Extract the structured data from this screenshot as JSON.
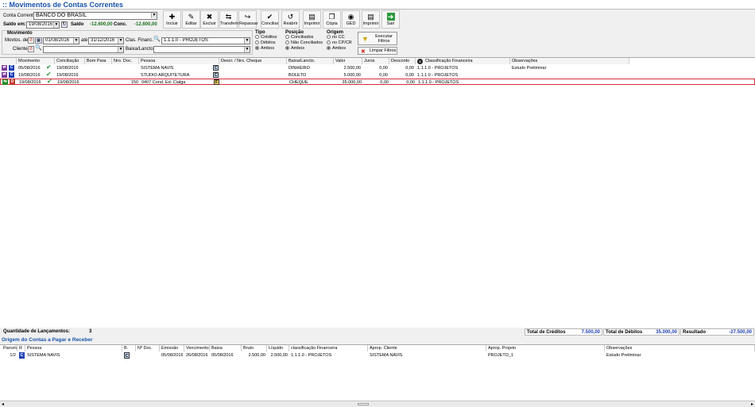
{
  "window": {
    "title": ":: Movimentos de Contas Correntes"
  },
  "account": {
    "label": "Conta Corrente",
    "value": "BANCO DO BRASIL"
  },
  "saldo": {
    "em_label": "Saldo em:",
    "date": "19/08/2016",
    "saldo_label": "Saldo",
    "saldo_value": "-12.600,00",
    "conc_label": "Conc.",
    "conc_value": "-12.600,00"
  },
  "toolbar": [
    {
      "label": "Incluir",
      "icon": "include-icon"
    },
    {
      "label": "Editar",
      "icon": "edit-icon"
    },
    {
      "label": "Excluir",
      "icon": "delete-icon"
    },
    {
      "label": "Transferir",
      "icon": "transfer-icon"
    },
    {
      "label": "Repassar",
      "icon": "forward-icon"
    },
    {
      "label": "Conciliar",
      "icon": "reconcile-icon"
    },
    {
      "label": "Reabrir",
      "icon": "reopen-icon"
    },
    {
      "label": "Imprimir",
      "icon": "print-icon"
    },
    {
      "label": "Cópia",
      "icon": "copy-icon"
    },
    {
      "label": "GED",
      "icon": "ged-icon"
    },
    {
      "label": "Imprimir",
      "icon": "print-icon"
    },
    {
      "label": "Sair",
      "icon": "exit-icon"
    }
  ],
  "filters": {
    "movimento_title": "Movimento",
    "movtos_label": "Movtos. de",
    "date_from": "01/08/2016",
    "ate_label": "até",
    "date_to": "31/12/2016",
    "cliente_label": "Cliente",
    "clasfinanc_label": "Clas. Financ.",
    "clasfinanc_value": "1.1.1.0 - PROJETOS",
    "baixa_label": "Baixa/Lancto."
  },
  "tipo": {
    "title": "Tipo",
    "options": [
      "Créditos",
      "Débitos",
      "Ambos"
    ],
    "selected": 2
  },
  "posicao": {
    "title": "Posição",
    "options": [
      "Conciliados",
      "Não Conciliados",
      "Ambos"
    ],
    "selected": 2
  },
  "origem": {
    "title": "Origem",
    "options": [
      "no CC",
      "no CP/CR",
      "Ambos"
    ],
    "selected": 2
  },
  "buttons": {
    "executar": "Executar Filtros",
    "limpar": "Limpar Filtros"
  },
  "grid": {
    "headers": [
      "Movimento",
      "Conciliação",
      "Bom Para",
      "Nro. Doc.",
      "Pessoa",
      "Descr. / Nro. Cheque",
      "Baixa/Lancto.",
      "Valor",
      "Juros",
      "Desconto",
      "Classificação Financeira",
      "Observações"
    ],
    "rows": [
      {
        "type": "C",
        "movimento": "05/08/2016",
        "conciliacao": "19/08/2016",
        "bompara": "",
        "nrodoc": "",
        "pessoa": "SISTEMA NAVIS",
        "tag": "C",
        "descr": "",
        "baixa": "DINHEIRO",
        "valor": "2.500,00",
        "juros": "0,00",
        "desconto": "0,00",
        "classif": "1.1.1.0 - PROJETOS",
        "obs": "Estudo Preliminar"
      },
      {
        "type": "C",
        "movimento": "19/08/2016",
        "conciliacao": "19/08/2016",
        "bompara": "",
        "nrodoc": "",
        "pessoa": "STUDIO ARQUITETURA",
        "tag": "C",
        "descr": "",
        "baixa": "BOLETO",
        "valor": "5.000,00",
        "juros": "0,00",
        "desconto": "0,00",
        "classif": "1.1.1.0 - PROJETOS",
        "obs": ""
      },
      {
        "type": "D",
        "movimento": "19/08/2016",
        "conciliacao": "19/08/2016",
        "bompara": "",
        "nrodoc": "150",
        "pessoa": "0407 Cond. Ed. Cialga",
        "tag": "F",
        "descr": "",
        "baixa": "CHEQUE",
        "valor": "35.000,00",
        "juros": "0,00",
        "desconto": "0,00",
        "classif": "1.1.1.0 - PROJETOS",
        "obs": ""
      }
    ]
  },
  "totals": {
    "qtd_label": "Quantidade de Lançamentos:",
    "qtd_value": "3",
    "creditos_label": "Total de Créditos",
    "creditos_value": "7.500,00",
    "debitos_label": "Total de Débitos",
    "debitos_value": "35.000,00",
    "resultado_label": "Resultado",
    "resultado_value": "-27.500,00"
  },
  "origin": {
    "title": "Origem do Contas a Pagar e Receber",
    "headers": [
      "Parcela",
      "R",
      "Pessoa",
      "B.",
      "Nº Doc.",
      "Emissão",
      "Vencimento",
      "Baixa",
      "Bruto",
      "Líquido",
      "classificação Financeira",
      "Aprop. Cliente",
      "Aprop. Projeto",
      "Observações"
    ],
    "rows": [
      {
        "parcela": "1/2",
        "r": "C",
        "pessoa": "SISTEMA NAVIS",
        "b": "C",
        "nrodoc": "",
        "emissao": "05/08/2016",
        "vencimento": "26/08/2016",
        "baixa": "05/08/2016",
        "bruto": "2.500,00",
        "liquido": "2.500,00",
        "classif": "1.1.1.0 - PROJETOS",
        "cliente": "SISTEMA NAVIS",
        "projeto": "PROJETO_1",
        "obs": "Estudo Preliminar"
      }
    ]
  },
  "colors": {
    "accent": "#1a53a8",
    "credit": "#1e3fb4",
    "debit": "#c0392b",
    "positive": "#1b6f1b",
    "selected_border": "#d0303a"
  }
}
